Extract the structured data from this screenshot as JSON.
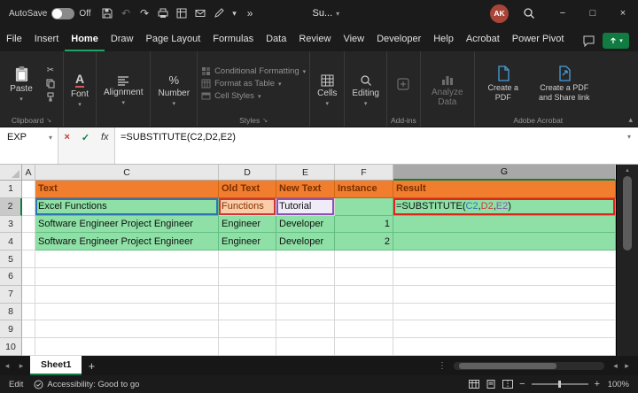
{
  "icons": {
    "chevron_down": "▾",
    "chevron_up": "▴",
    "undo": "↶",
    "redo": "↷",
    "more": "»",
    "minimize": "−",
    "maximize": "□",
    "close": "×",
    "cancel": "×",
    "check": "✓",
    "ellipsis": "⋮",
    "left": "◂",
    "right": "▸",
    "up": "▴",
    "down": "▾",
    "minus": "−",
    "plus": "+",
    "cut": "✂",
    "percent": "%",
    "letter_a": "A",
    "launcher": "↘"
  },
  "titlebar": {
    "autosave": "AutoSave",
    "autosave_state": "Off",
    "doc_title": "Su...",
    "avatar": "AK"
  },
  "menubar": {
    "items": [
      "File",
      "Insert",
      "Home",
      "Draw",
      "Page Layout",
      "Formulas",
      "Data",
      "Review",
      "View",
      "Developer",
      "Help",
      "Acrobat",
      "Power Pivot"
    ]
  },
  "ribbon": {
    "paste": "Paste",
    "font": "Font",
    "alignment": "Alignment",
    "number": "Number",
    "styles_items": [
      "Conditional Formatting",
      "Format as Table",
      "Cell Styles"
    ],
    "cells": "Cells",
    "editing": "Editing",
    "analyze": "Analyze Data",
    "acrobat_create": "Create a PDF",
    "acrobat_share": "Create a PDF and Share link",
    "group_labels": [
      "Clipboard",
      "Styles",
      "Add-ins",
      "Adobe Acrobat"
    ]
  },
  "formula_bar": {
    "name_box": "EXP",
    "fx": "fx"
  },
  "formula": {
    "prefix": "=SUBSTITUTE(",
    "ref1": "C2",
    "sep1": ",",
    "ref2": "D2",
    "sep2": ",",
    "ref3": "E2",
    "close": ")"
  },
  "grid": {
    "col_headers": [
      "A",
      "C",
      "D",
      "E",
      "F",
      "G"
    ],
    "row_headers": [
      "1",
      "2",
      "3",
      "4",
      "5",
      "6",
      "7",
      "8",
      "9",
      "10"
    ],
    "r1": {
      "c": "Text",
      "d": "Old Text",
      "e": "New Text",
      "f": "Instance",
      "g": "Result"
    },
    "r2": {
      "c": "Excel Functions",
      "d": "Functions",
      "e": "Tutorial"
    },
    "r3": {
      "c": "Software Engineer Project Engineer",
      "d": "Engineer",
      "e": "Developer",
      "f": "1"
    },
    "r4": {
      "c": "Software Engineer Project Engineer",
      "d": "Engineer",
      "e": "Developer",
      "f": "2"
    }
  },
  "tabbar": {
    "active": "Sheet1",
    "add": "+"
  },
  "statusbar": {
    "mode": "Edit",
    "accessibility": "Accessibility: Good to go",
    "zoom": "100%"
  },
  "colors": {
    "accent_green": "#107C41",
    "header_fill": "#F07E2E",
    "header_text": "#7A2E00",
    "row_fill": "#8EE0A6",
    "ref1": "#2E75B6",
    "ref2": "#D13438",
    "ref3": "#8F4FB5",
    "annotation_red": "#E0241B",
    "peach_fill": "#F9CDA9",
    "lavender_fill": "#EFEBF7"
  }
}
